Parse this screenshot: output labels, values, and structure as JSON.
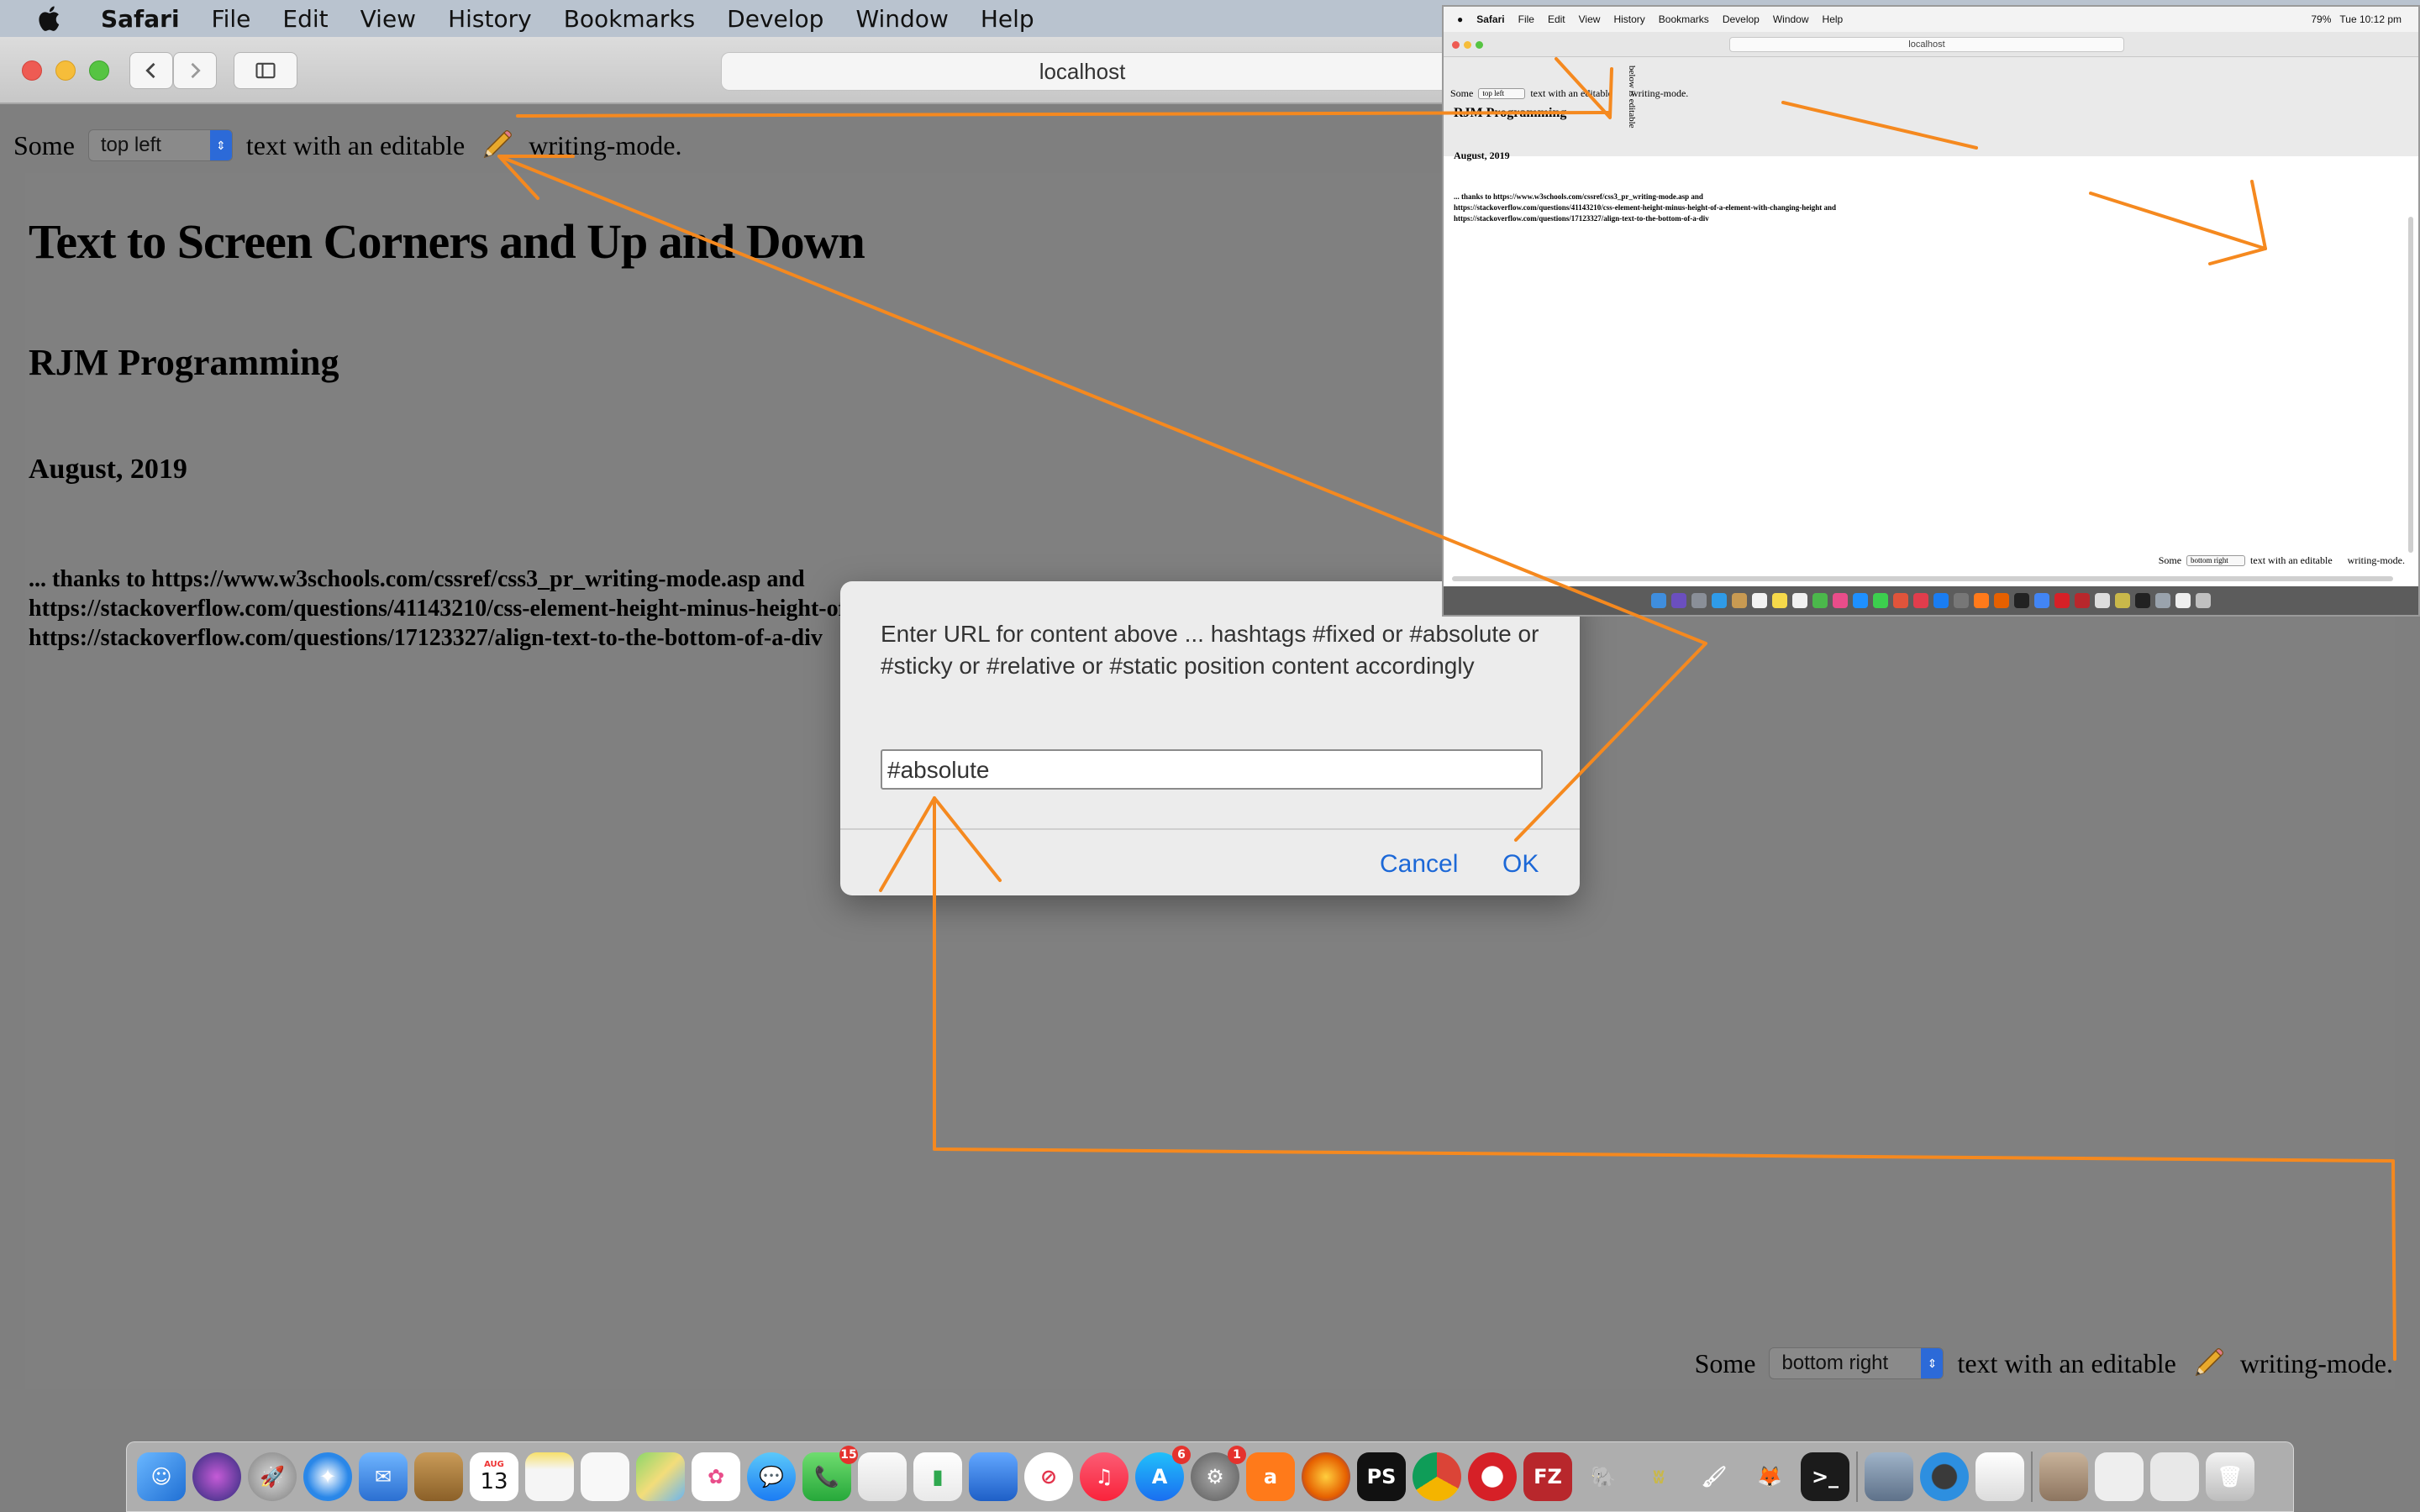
{
  "menubar": {
    "app_name": "Safari",
    "items": [
      "File",
      "Edit",
      "View",
      "History",
      "Bookmarks",
      "Develop",
      "Window",
      "Help"
    ]
  },
  "browser": {
    "url": "localhost"
  },
  "page": {
    "top_line": {
      "prefix": "Some",
      "select_value": "top left",
      "middle": "text with an editable",
      "suffix": "writing-mode."
    },
    "title": "Text to Screen Corners and Up and Down",
    "author": "RJM Programming",
    "date": "August, 2019",
    "thanks": [
      "... thanks to https://www.w3schools.com/cssref/css3_pr_writing-mode.asp and",
      "https://stackoverflow.com/questions/41143210/css-element-height-minus-height-of-a-element-with-changing-height and",
      "https://stackoverflow.com/questions/17123327/align-text-to-the-bottom-of-a-div"
    ],
    "bottom_line": {
      "prefix": "Some",
      "select_value": "bottom right",
      "middle": "text with an editable",
      "suffix": "writing-mode."
    }
  },
  "dialog": {
    "message": "Enter URL for content above ... hashtags #fixed or #absolute or #sticky or #relative or #static position content accordingly",
    "input_value": "#absolute",
    "cancel_label": "Cancel",
    "ok_label": "OK"
  },
  "inset": {
    "menubar_app": "Safari",
    "menubar_items": [
      "File",
      "Edit",
      "View",
      "History",
      "Bookmarks",
      "Develop",
      "Window",
      "Help"
    ],
    "battery": "79%",
    "clock": "Tue 10:12 pm",
    "url": "localhost",
    "top_line": {
      "prefix": "Some",
      "select_value": "top left",
      "middle": "text with an editable",
      "suffix": "writing-mode."
    },
    "vertical_text": "below is editable",
    "author": "RJM Programming",
    "date": "August, 2019",
    "thanks": [
      "... thanks to https://www.w3schools.com/cssref/css3_pr_writing-mode.asp and",
      "https://stackoverflow.com/questions/41143210/css-element-height-minus-height-of-a-element-with-changing-height and",
      "https://stackoverflow.com/questions/17123327/align-text-to-the-bottom-of-a-div"
    ],
    "bottom_line": {
      "prefix": "Some",
      "select_value": "bottom right",
      "middle": "text with an editable",
      "suffix": "writing-mode."
    }
  },
  "dock": {
    "calendar_month": "AUG",
    "calendar_day": "13",
    "facetime_badge": "15",
    "appstore_badge": "6",
    "prefs_badge": "1"
  },
  "colors": {
    "annotation": "#f5891f",
    "accent": "#1c68d7",
    "page_background": "#7f7f7f"
  }
}
